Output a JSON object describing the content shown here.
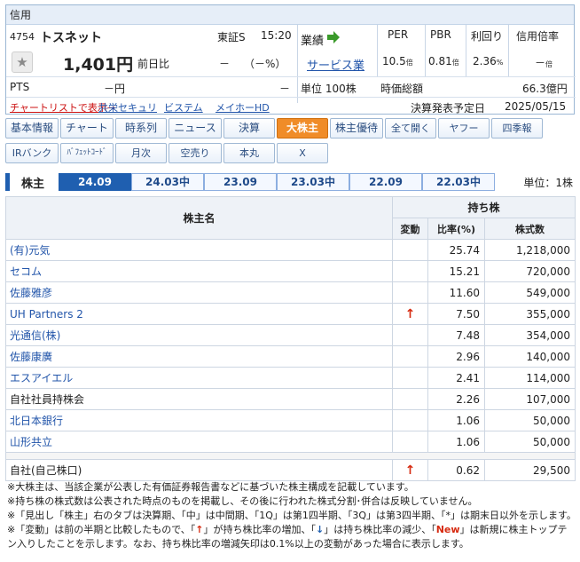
{
  "panel": {
    "header": "信用",
    "code": "4754",
    "name": "トスネット",
    "market": "東証S",
    "time": "15:20",
    "price": "1,401円",
    "prev_label": "前日比",
    "change": "－",
    "change_pct": "（－%）",
    "pts_label": "PTS",
    "pts_value": "－円",
    "pts_dash": "－",
    "gyoseki_label": "業績",
    "sector": "サービス業",
    "unit_label": "単位 100株",
    "per_label": "PER",
    "pbr_label": "PBR",
    "yield_label": "利回り",
    "margin_label": "信用倍率",
    "per_value": "10.5",
    "per_unit": "倍",
    "pbr_value": "0.81",
    "pbr_unit": "倍",
    "yield_value": "2.36",
    "yield_unit": "%",
    "margin_value": "－",
    "margin_unit": "倍",
    "mcap_label": "時価総額",
    "mcap_value": "66.3億円",
    "chartlist_link": "チャートリストで表示→",
    "broker1": "共栄セキュリ",
    "broker2": "ビステム",
    "broker3": "メイホーHD",
    "earnings_label": "決算発表予定日",
    "earnings_date": "2025/05/15"
  },
  "tabs_row1": [
    "基本情報",
    "チャート",
    "時系列",
    "ニュース",
    "決算",
    "大株主",
    "株主優待",
    "全て開く",
    "ヤフー",
    "四季報"
  ],
  "tabs_row2": [
    "IRバンク",
    "ﾊﾞﾌｪｯﾄｺｰﾄﾞ",
    "月次",
    "空売り",
    "本丸",
    "X"
  ],
  "period_bar": {
    "title": "株主",
    "periods": [
      "24.09",
      "24.03中",
      "23.09",
      "23.03中",
      "22.09",
      "22.03中"
    ],
    "unit": "単位：1株"
  },
  "table": {
    "h_name": "株主名",
    "h_holding": "持ち株",
    "h_change": "変動",
    "h_ratio": "比率(%)",
    "h_shares": "株式数",
    "rows": [
      {
        "name": "(有)元気",
        "change": "",
        "ratio": "25.74",
        "shares": "1,218,000"
      },
      {
        "name": "セコム",
        "change": "",
        "ratio": "15.21",
        "shares": "720,000"
      },
      {
        "name": "佐藤雅彦",
        "change": "",
        "ratio": "11.60",
        "shares": "549,000"
      },
      {
        "name": "UH Partners 2",
        "change": "↑",
        "ratio": "7.50",
        "shares": "355,000"
      },
      {
        "name": "光通信(株)",
        "change": "",
        "ratio": "7.48",
        "shares": "354,000"
      },
      {
        "name": "佐藤康廣",
        "change": "",
        "ratio": "2.96",
        "shares": "140,000"
      },
      {
        "name": "エスアイエル",
        "change": "",
        "ratio": "2.41",
        "shares": "114,000"
      },
      {
        "name": "自社社員持株会",
        "change": "",
        "ratio": "2.26",
        "shares": "107,000"
      },
      {
        "name": "北日本銀行",
        "change": "",
        "ratio": "1.06",
        "shares": "50,000"
      },
      {
        "name": "山形共立",
        "change": "",
        "ratio": "1.06",
        "shares": "50,000"
      }
    ],
    "self_row": {
      "name": "自社(自己株口)",
      "change": "↑",
      "ratio": "0.62",
      "shares": "29,500"
    }
  },
  "notes": {
    "n1": "※大株主は、当該企業が公表した有価証券報告書などに基づいた株主構成を記載しています。",
    "n2": "※持ち株の株式数は公表された時点のものを掲載し、その後に行われた株式分割･併合は反映していません。",
    "n3": "※「見出し「株主」右のタブは決算期、「中」は中間期、「1Q」は第1四半期、「3Q」は第3四半期、「*」は期末日以外を示します。",
    "n4a": "※「変動」は前の半期と比較したもので、「",
    "n4_up": "↑",
    "n4b": "」が持ち株比率の増加、「",
    "n4_down": "↓",
    "n4c": "」は持ち株比率の減少、「",
    "n4_new": "New",
    "n4d": "」は新規に株主トップテ",
    "n5": "ン入りしたことを示します。なお、持ち株比率の増減矢印は0.1%以上の変動があった場合に表示します。"
  },
  "colors": {
    "accent_tab": "#f08c28",
    "period_active": "#1f5fb0",
    "link": "#2255aa",
    "up_arrow": "#d62a10"
  }
}
